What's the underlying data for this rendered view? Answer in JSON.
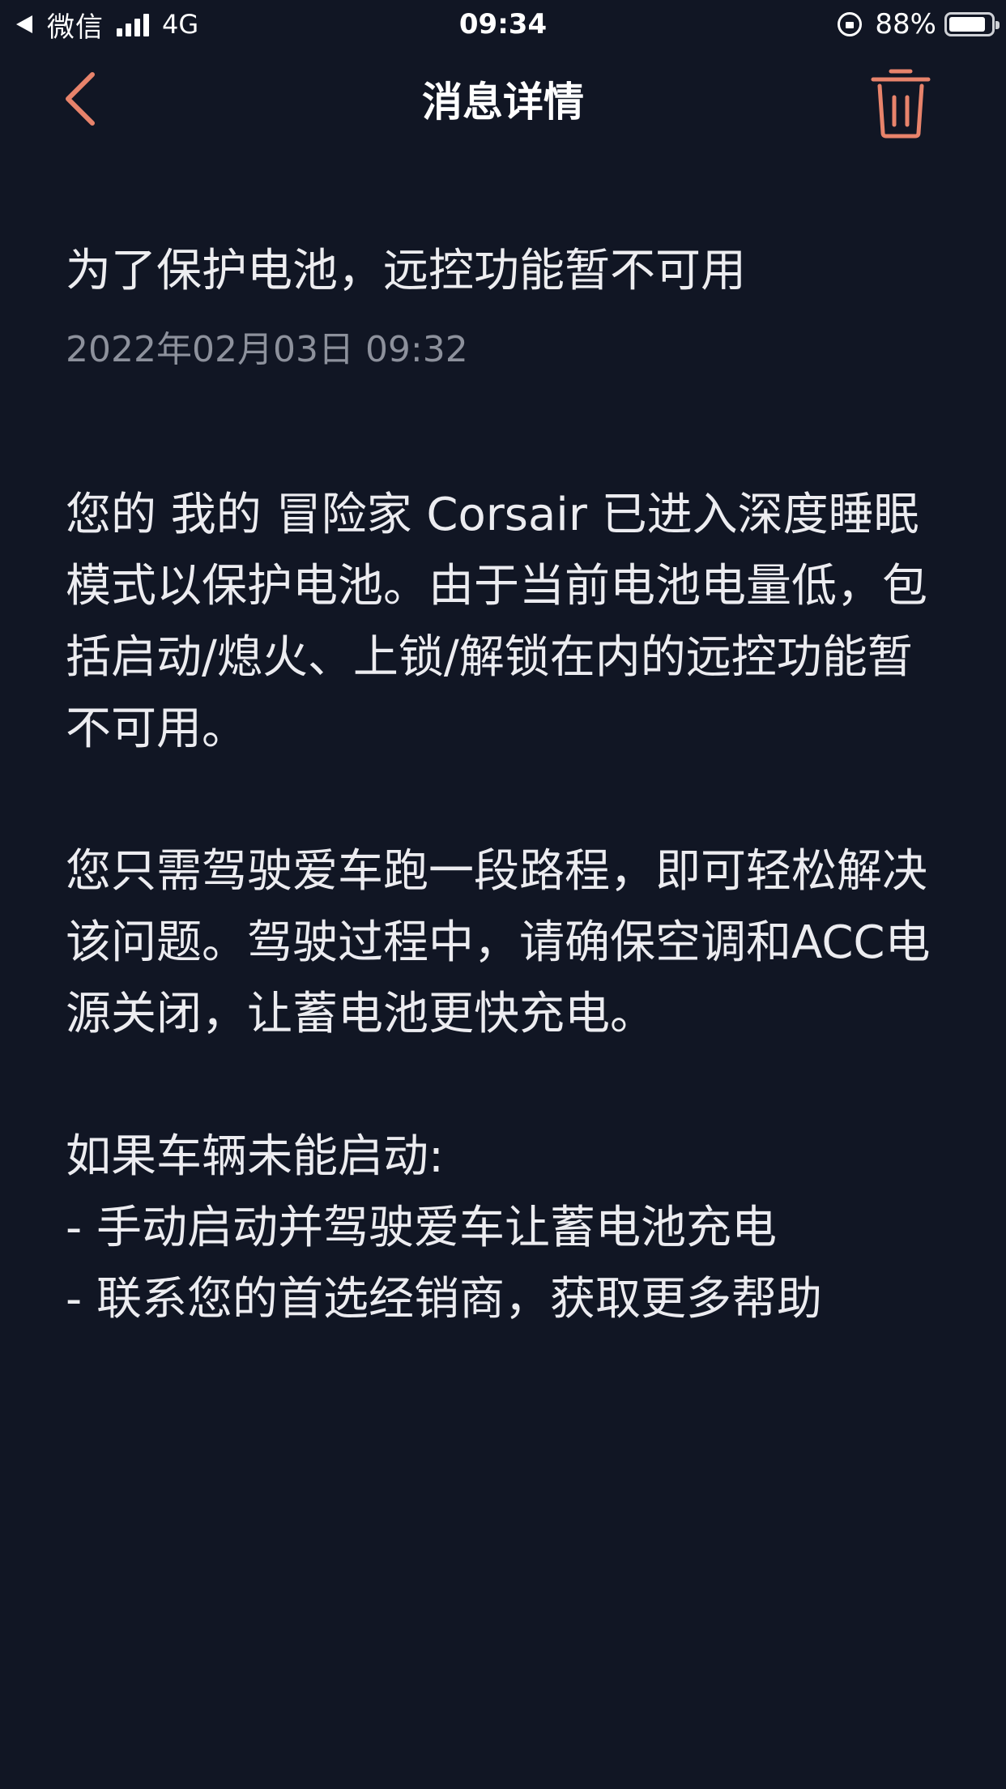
{
  "status_bar": {
    "carrier": "微信",
    "network": "4G",
    "time": "09:34",
    "battery_pct": "88%",
    "battery_level": 0.88
  },
  "nav": {
    "title": "消息详情",
    "accent_color": "#E8836B"
  },
  "message": {
    "title": "为了保护电池，远控功能暂不可用",
    "timestamp": "2022年02月03日 09:32",
    "paragraphs": [
      "您的 我的 冒险家 Corsair 已进入深度睡眠模式以保护电池。由于当前电池电量低，包括启动/熄火、上锁/解锁在内的远控功能暂不可用。",
      "您只需驾驶爱车跑一段路程，即可轻松解决该问题。驾驶过程中，请确保空调和ACC电源关闭，让蓄电池更快充电。",
      "如果车辆未能启动:\n- 手动启动并驾驶爱车让蓄电池充电\n- 联系您的首选经销商，获取更多帮助"
    ]
  }
}
